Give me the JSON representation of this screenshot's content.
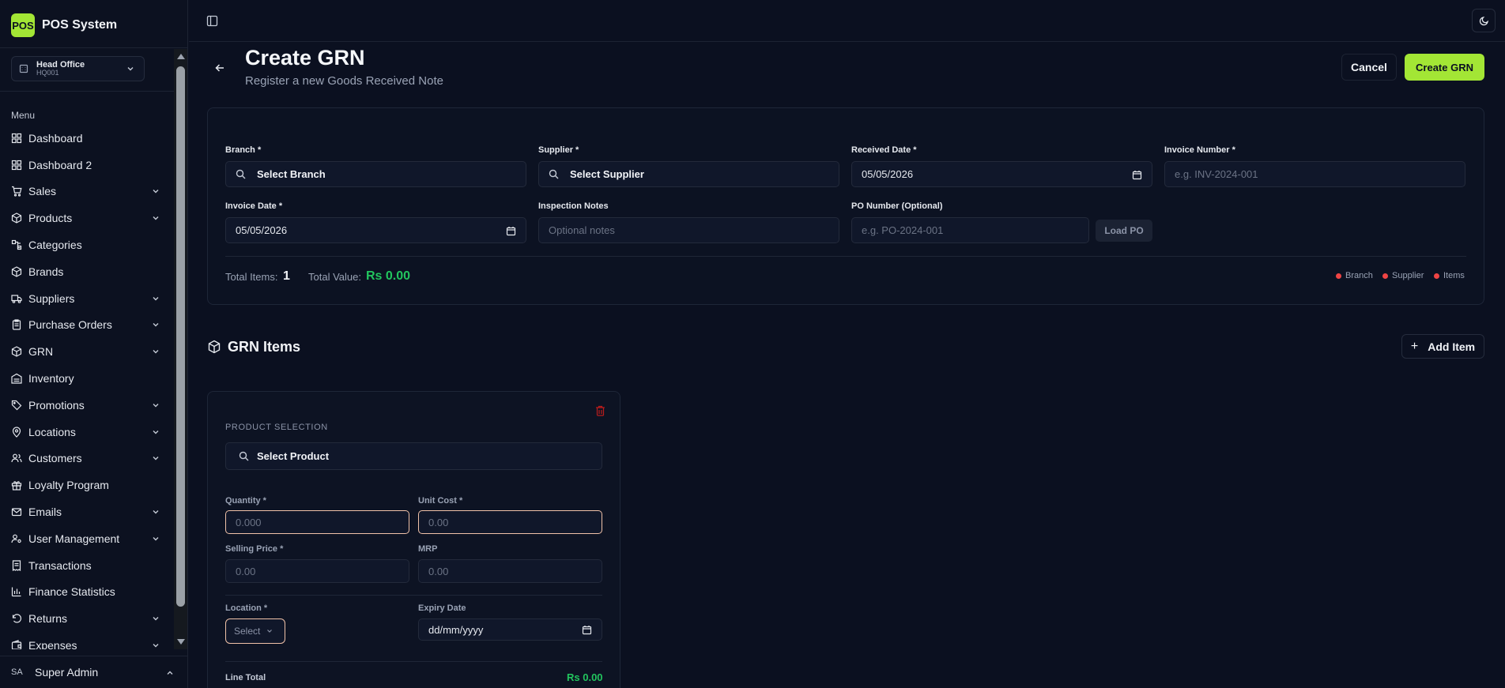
{
  "app": {
    "logo_text": "POS",
    "name": "POS System"
  },
  "branch_selector": {
    "name": "Head Office",
    "code": "HQ001"
  },
  "sidebar": {
    "menu_label": "Menu",
    "items": [
      {
        "label": "Dashboard",
        "icon": "dashboard-icon",
        "expandable": false
      },
      {
        "label": "Dashboard 2",
        "icon": "dashboard-icon",
        "expandable": false
      },
      {
        "label": "Sales",
        "icon": "cart-icon",
        "expandable": true
      },
      {
        "label": "Products",
        "icon": "package-icon",
        "expandable": true
      },
      {
        "label": "Categories",
        "icon": "categories-icon",
        "expandable": false
      },
      {
        "label": "Brands",
        "icon": "package-icon",
        "expandable": false
      },
      {
        "label": "Suppliers",
        "icon": "truck-icon",
        "expandable": true
      },
      {
        "label": "Purchase Orders",
        "icon": "clipboard-icon",
        "expandable": true
      },
      {
        "label": "GRN",
        "icon": "package-icon",
        "expandable": true
      },
      {
        "label": "Inventory",
        "icon": "warehouse-icon",
        "expandable": false
      },
      {
        "label": "Promotions",
        "icon": "tag-icon",
        "expandable": true
      },
      {
        "label": "Locations",
        "icon": "map-pin-icon",
        "expandable": true
      },
      {
        "label": "Customers",
        "icon": "users-icon",
        "expandable": true
      },
      {
        "label": "Loyalty Program",
        "icon": "gift-icon",
        "expandable": false
      },
      {
        "label": "Emails",
        "icon": "mail-icon",
        "expandable": true
      },
      {
        "label": "User Management",
        "icon": "user-cog-icon",
        "expandable": true
      },
      {
        "label": "Transactions",
        "icon": "receipt-icon",
        "expandable": false
      },
      {
        "label": "Finance Statistics",
        "icon": "bar-chart-icon",
        "expandable": false
      },
      {
        "label": "Returns",
        "icon": "undo-icon",
        "expandable": true
      },
      {
        "label": "Expenses",
        "icon": "wallet-icon",
        "expandable": true
      }
    ]
  },
  "user": {
    "initials": "SA",
    "name": "Super Admin"
  },
  "header": {
    "title": "Create GRN",
    "subtitle": "Register a new Goods Received Note",
    "cancel_label": "Cancel",
    "create_label": "Create GRN"
  },
  "form": {
    "branch": {
      "label": "Branch *",
      "value": "Select Branch"
    },
    "supplier": {
      "label": "Supplier *",
      "value": "Select Supplier"
    },
    "received_date": {
      "label": "Received Date *",
      "value": "05/05/2026"
    },
    "invoice_number": {
      "label": "Invoice Number *",
      "placeholder": "e.g. INV-2024-001"
    },
    "invoice_date": {
      "label": "Invoice Date *",
      "value": "05/05/2026"
    },
    "inspection_notes": {
      "label": "Inspection Notes",
      "placeholder": "Optional notes"
    },
    "po_number": {
      "label": "PO Number (Optional)",
      "placeholder": "e.g. PO-2024-001",
      "load_label": "Load PO"
    }
  },
  "summary": {
    "total_items_label": "Total Items:",
    "total_items_value": "1",
    "total_value_label": "Total Value:",
    "total_value_value": "Rs 0.00",
    "legend": [
      "Branch",
      "Supplier",
      "Items"
    ],
    "legend_color": "#ef4444"
  },
  "grn_items": {
    "title": "GRN Items",
    "add_label": "Add Item",
    "card": {
      "product_selection_label": "PRODUCT SELECTION",
      "product_value": "Select Product",
      "quantity": {
        "label": "Quantity *",
        "placeholder": "0.000"
      },
      "unit_cost": {
        "label": "Unit Cost *",
        "placeholder": "0.00"
      },
      "selling_price": {
        "label": "Selling Price *",
        "placeholder": "0.00"
      },
      "mrp": {
        "label": "MRP",
        "placeholder": "0.00"
      },
      "location": {
        "label": "Location *",
        "value": "Select"
      },
      "expiry_date": {
        "label": "Expiry Date",
        "value": "dd/mm/yyyy"
      },
      "line_total_label": "Line Total",
      "line_total_value": "Rs 0.00"
    }
  },
  "colors": {
    "accent": "#a3e635",
    "success": "#22c55e",
    "danger": "#ef4444",
    "background": "#0b1020"
  }
}
